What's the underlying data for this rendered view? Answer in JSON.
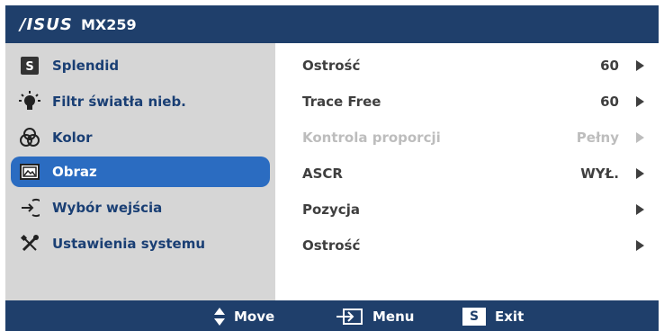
{
  "header": {
    "brand": "/ISUS",
    "model": "MX259"
  },
  "sidebar": {
    "items": [
      {
        "label": "Splendid",
        "icon": "s-box-icon",
        "selected": false
      },
      {
        "label": "Filtr światła nieb.",
        "icon": "bulb-icon",
        "selected": false
      },
      {
        "label": "Kolor",
        "icon": "color-wheel-icon",
        "selected": false
      },
      {
        "label": "Obraz",
        "icon": "picture-icon",
        "selected": true
      },
      {
        "label": "Wybór wejścia",
        "icon": "input-arrow-icon",
        "selected": false
      },
      {
        "label": "Ustawienia systemu",
        "icon": "tools-icon",
        "selected": false
      }
    ]
  },
  "content": {
    "rows": [
      {
        "label": "Ostrość",
        "value": "60",
        "disabled": false
      },
      {
        "label": "Trace Free",
        "value": "60",
        "disabled": false
      },
      {
        "label": "Kontrola proporcji",
        "value": "Pełny",
        "disabled": true
      },
      {
        "label": "ASCR",
        "value": "WYŁ.",
        "disabled": false
      },
      {
        "label": "Pozycja",
        "value": "",
        "disabled": false
      },
      {
        "label": "Ostrość",
        "value": "",
        "disabled": false
      }
    ]
  },
  "footer": {
    "move": "Move",
    "menu": "Menu",
    "exit_badge": "S",
    "exit": "Exit"
  },
  "colors": {
    "header_bg": "#1f3f6b",
    "sidebar_bg": "#d6d6d6",
    "selected_bg": "#2b6cc1",
    "text_blue": "#1a3f74"
  }
}
